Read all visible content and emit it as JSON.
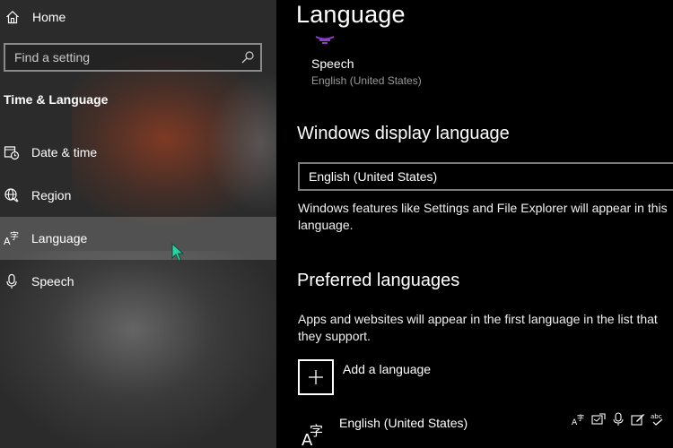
{
  "sidebar": {
    "home_label": "Home",
    "search_placeholder": "Find a setting",
    "section_title": "Time & Language",
    "items": [
      {
        "label": "Date & time",
        "icon": "calendar-clock-icon"
      },
      {
        "label": "Region",
        "icon": "globe-icon"
      },
      {
        "label": "Language",
        "icon": "language-icon",
        "selected": true
      },
      {
        "label": "Speech",
        "icon": "microphone-icon"
      }
    ]
  },
  "main": {
    "title": "Language",
    "speech": {
      "label": "Speech",
      "value": "English (United States)"
    },
    "display_language": {
      "heading": "Windows display language",
      "selected": "English (United States)",
      "description": "Windows features like Settings and File Explorer will appear in this language."
    },
    "preferred": {
      "heading": "Preferred languages",
      "description": "Apps and websites will appear in the first language in the list that they support.",
      "add_label": "Add a language",
      "languages": [
        {
          "name": "English (United States)"
        }
      ]
    }
  },
  "colors": {
    "sidebar_bg": "#2b2b2b",
    "main_bg": "#000000",
    "accent_speech": "#8b3ec9",
    "cursor": "#2ad1a3"
  }
}
